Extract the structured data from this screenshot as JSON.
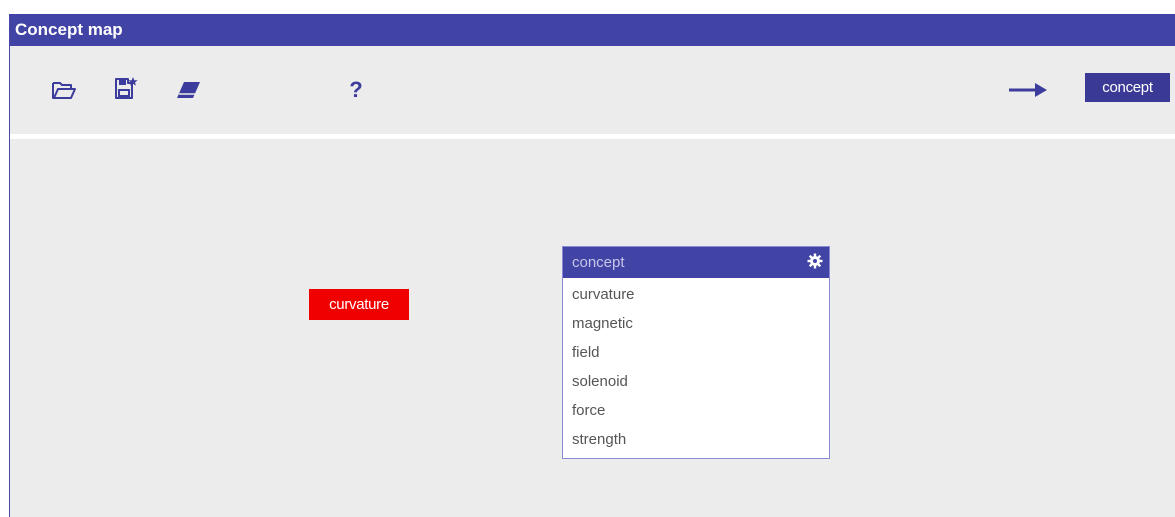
{
  "window": {
    "title": "Concept map"
  },
  "toolbar": {
    "open_icon": "folder-open-icon",
    "save_icon": "save-star-icon",
    "erase_icon": "eraser-icon",
    "help_label": "?",
    "arrow_icon": "arrow-right-icon",
    "concept_label": "concept"
  },
  "canvas": {
    "node": {
      "label": "curvature",
      "color": "#f10000"
    },
    "concept_list": {
      "header": "concept",
      "settings_icon": "gear-icon",
      "items": [
        "curvature",
        "magnetic",
        "field",
        "solenoid",
        "force",
        "strength"
      ]
    }
  },
  "colors": {
    "accent": "#4244a5",
    "background": "#ececec",
    "node": "#f10000"
  }
}
